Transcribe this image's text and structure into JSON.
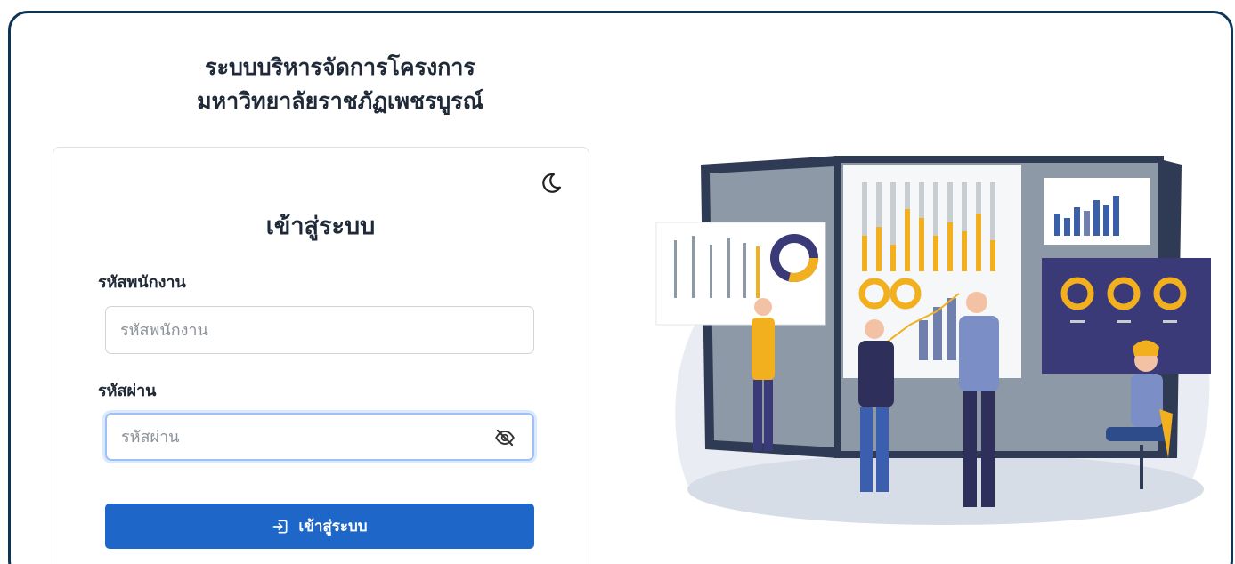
{
  "header": {
    "title_line1": "ระบบบริหารจัดการโครงการ",
    "title_line2": "มหาวิทยาลัยราชภัฏเพชรบูรณ์"
  },
  "login": {
    "heading": "เข้าสู่ระบบ",
    "username_label": "รหัสพนักงาน",
    "username_placeholder": "รหัสพนักงาน",
    "username_value": "",
    "password_label": "รหัสผ่าน",
    "password_placeholder": "รหัสผ่าน",
    "password_value": "",
    "submit_label": "เข้าสู่ระบบ"
  },
  "icons": {
    "theme_toggle": "moon-icon",
    "password_visibility": "eye-slash-icon",
    "submit": "login-arrow-icon"
  },
  "colors": {
    "frame_border": "#0f3455",
    "primary": "#1e67c9",
    "focus_ring": "#9ec0f4",
    "illustration_accent": "#f2b01e",
    "illustration_navy": "#3a3a78"
  }
}
